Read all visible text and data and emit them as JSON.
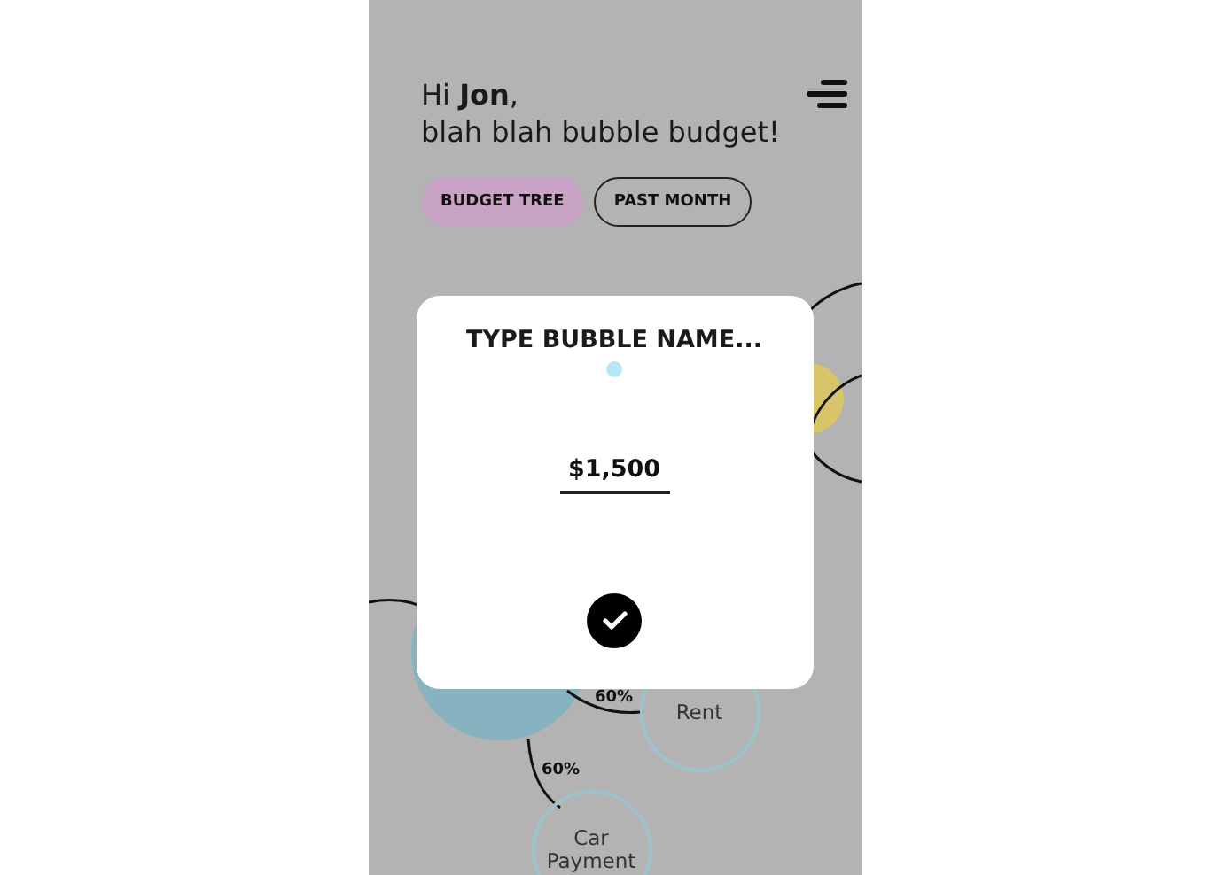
{
  "greeting": {
    "line1": "Hi **Jon**,",
    "line2": "blah blah bubble budget!"
  },
  "tabs": [
    {
      "label": "BUDGET TREE",
      "selected": true
    },
    {
      "label": "PAST MONTH",
      "selected": false
    }
  ],
  "bubbles": [
    {
      "label": "Rent",
      "kind": "outline"
    },
    {
      "label": "Car Payment",
      "kind": "outline"
    }
  ],
  "links": [
    {
      "label": "60%"
    },
    {
      "label": "60%"
    }
  ],
  "modal": {
    "placeholder": "TYPE BUBBLE NAME...",
    "amount": "$1,500"
  }
}
